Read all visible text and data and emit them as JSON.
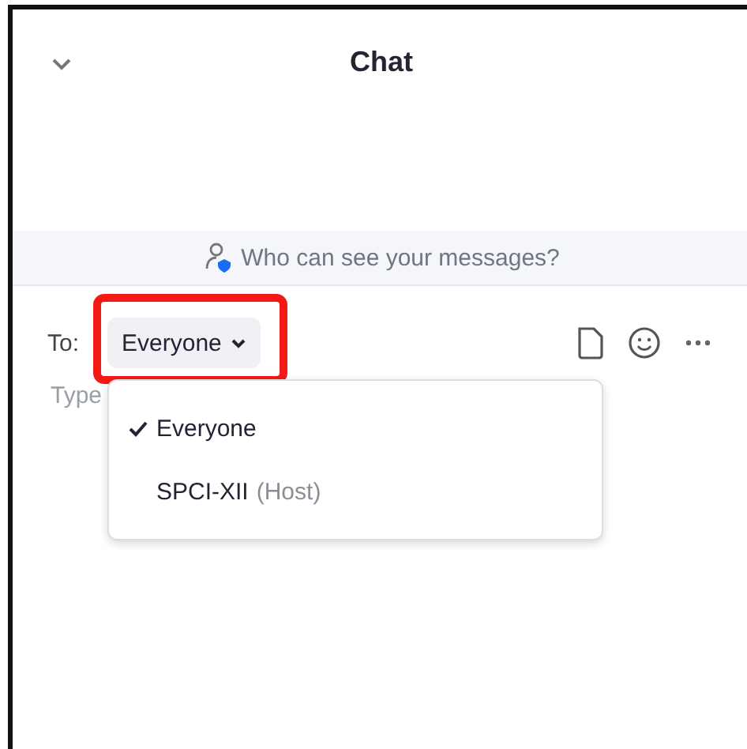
{
  "header": {
    "title": "Chat"
  },
  "banner": {
    "text": "Who can see your messages?"
  },
  "composer": {
    "to_label": "To:",
    "recipient": "Everyone",
    "placeholder": "Type",
    "highlighted": true
  },
  "recipient_menu": [
    {
      "name": "Everyone",
      "selected": true
    },
    {
      "name": "SPCI-XII",
      "role": "(Host)",
      "selected": false
    }
  ]
}
